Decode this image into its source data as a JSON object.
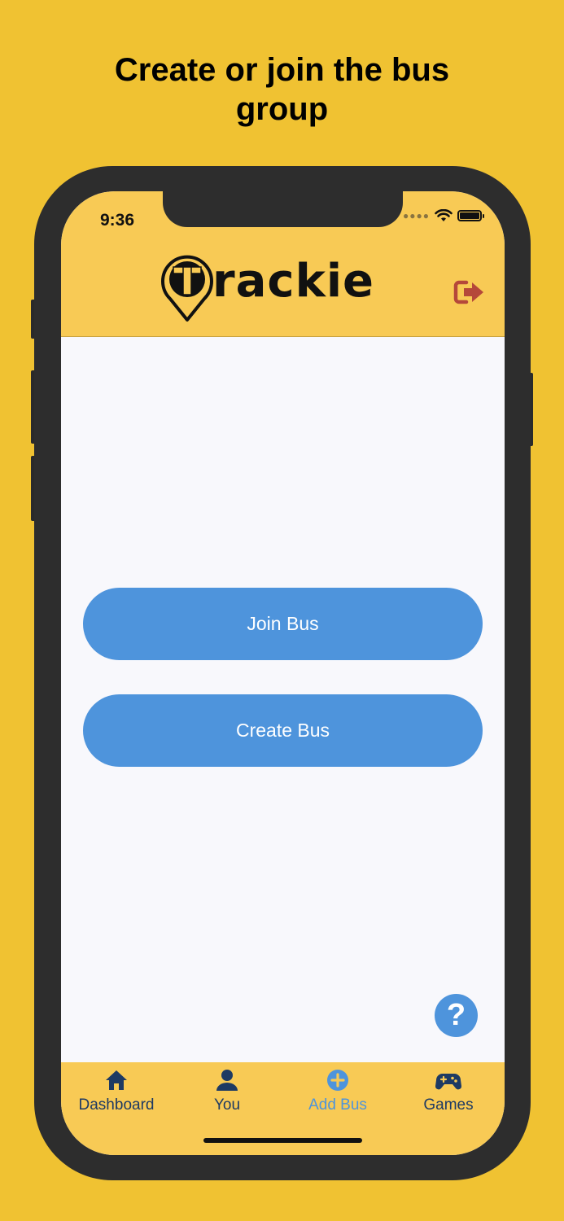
{
  "promo": {
    "headline_line1": "Create or join the bus",
    "headline_line2": "group"
  },
  "status_bar": {
    "time": "9:36"
  },
  "header": {
    "logo_text": "rackie",
    "logo_letter": "T"
  },
  "main": {
    "join_button": "Join Bus",
    "create_button": "Create Bus",
    "help_label": "?"
  },
  "tabs": [
    {
      "label": "Dashboard",
      "icon": "home-icon",
      "active": false
    },
    {
      "label": "You",
      "icon": "person-icon",
      "active": false
    },
    {
      "label": "Add Bus",
      "icon": "plus-circle-icon",
      "active": true
    },
    {
      "label": "Games",
      "icon": "gamepad-icon",
      "active": false
    }
  ],
  "colors": {
    "background": "#F0C232",
    "header": "#F8CA55",
    "button": "#4E94DC",
    "tab_text": "#1E3A63",
    "logout": "#B5483A"
  }
}
